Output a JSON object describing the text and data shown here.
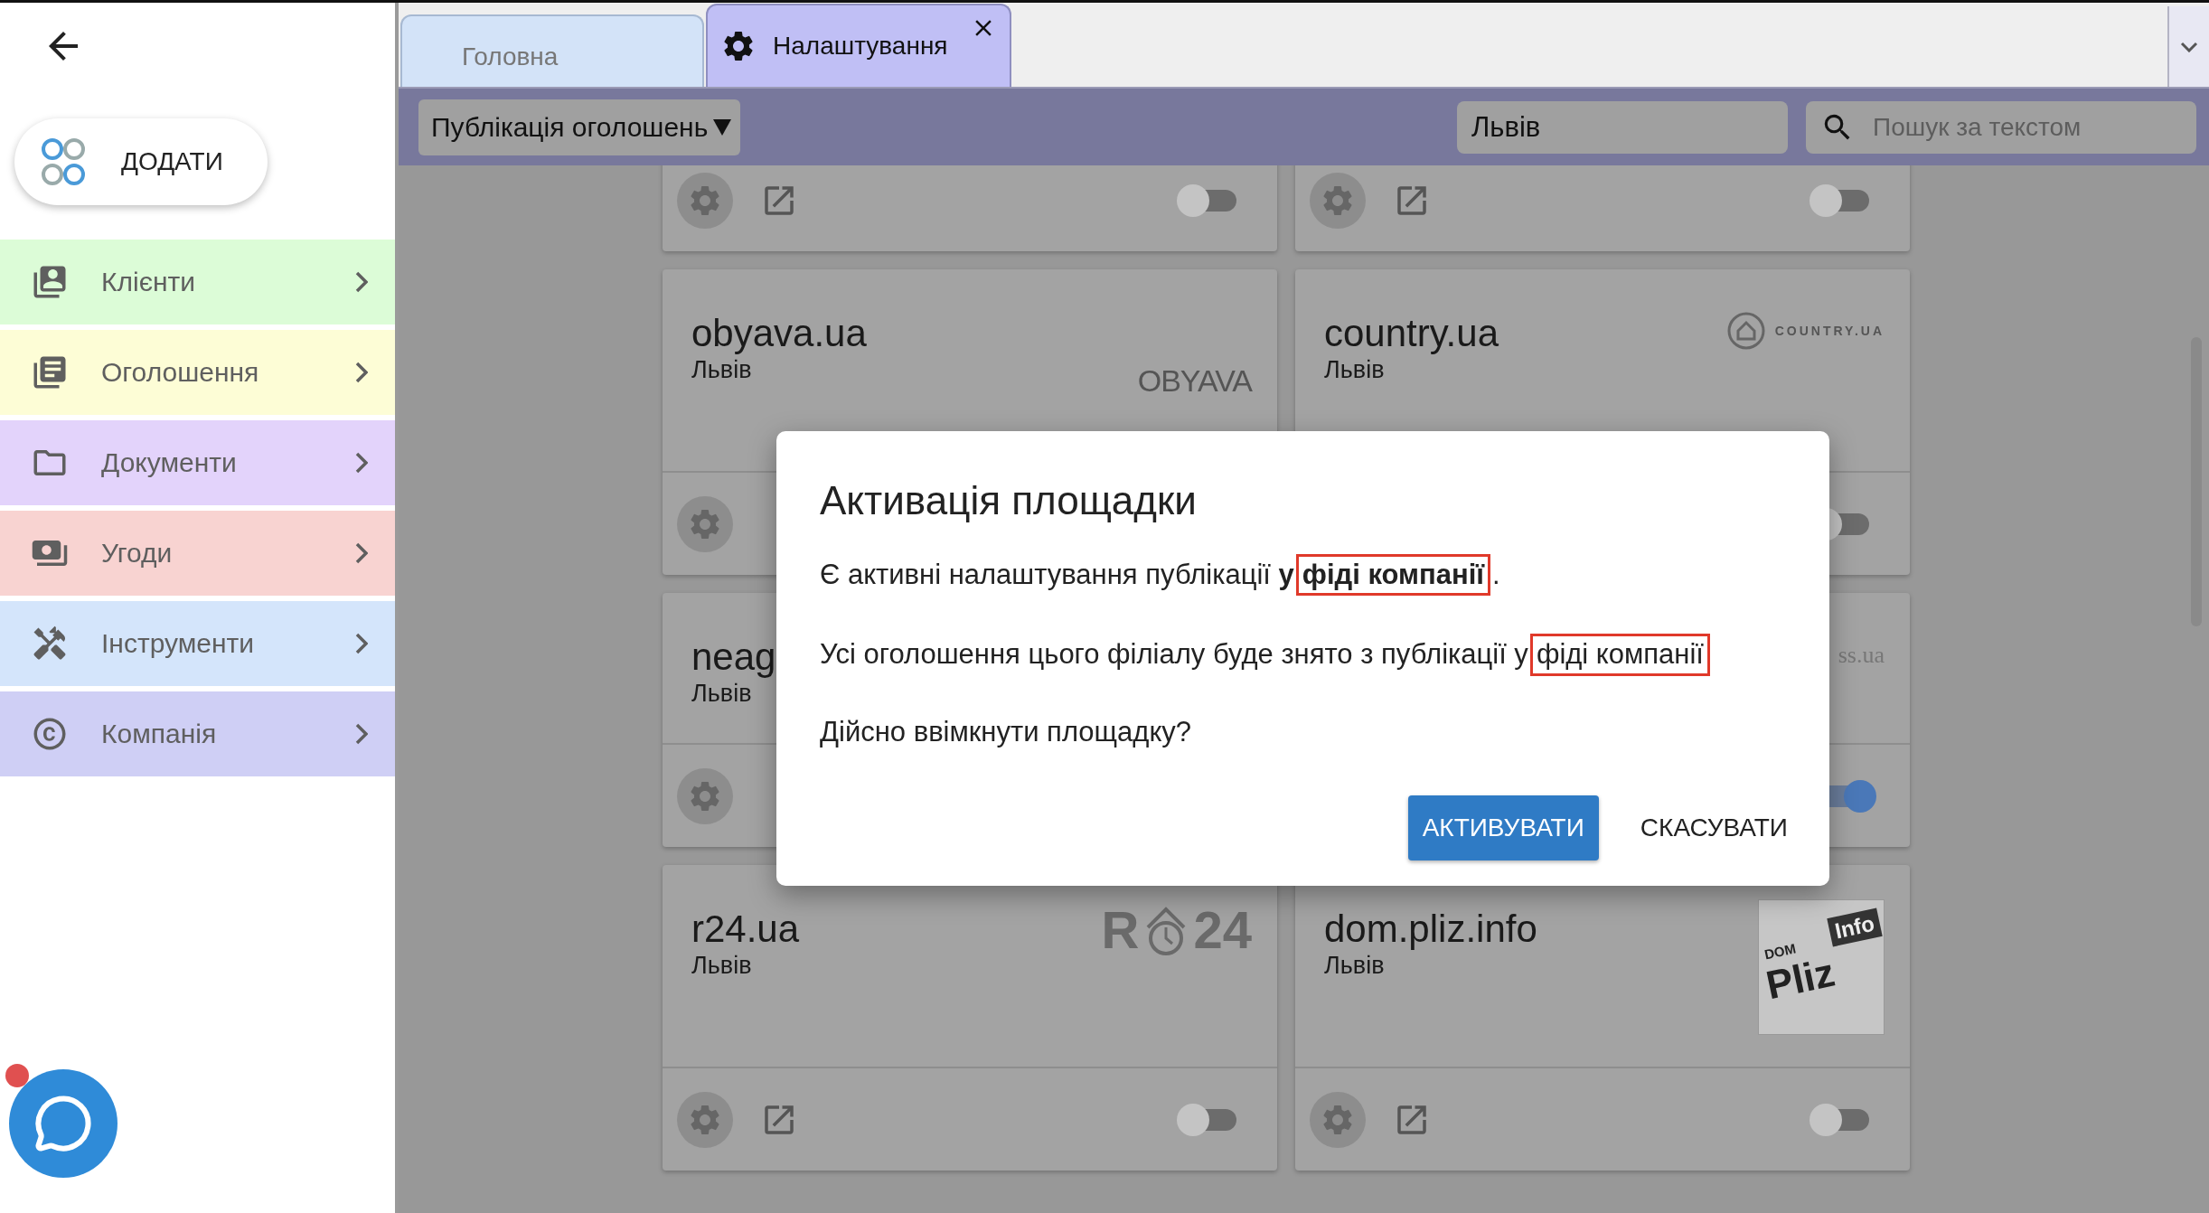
{
  "sidebar": {
    "add_button": "ДОДАТИ",
    "items": [
      {
        "label": "Клієнти",
        "color": "#dcfcd7"
      },
      {
        "label": "Оголошення",
        "color": "#fdfdd6"
      },
      {
        "label": "Документи",
        "color": "#e3d3fb"
      },
      {
        "label": "Угоди",
        "color": "#f8d3d1"
      },
      {
        "label": "Інструменти",
        "color": "#d4e5fb"
      },
      {
        "label": "Компанія",
        "color": "#cfcff5"
      }
    ],
    "chat": {
      "has_notification": true
    }
  },
  "tabs": [
    {
      "label": "Головна",
      "selected": false,
      "closable": false
    },
    {
      "label": "Налаштування",
      "selected": true,
      "closable": true
    }
  ],
  "toolbar": {
    "section": "Публікація оголошень",
    "city": "Львів",
    "search": {
      "placeholder": "Пошук за текстом"
    }
  },
  "cards": [
    {
      "footer": [
        {
          "kind": "settings"
        },
        {
          "kind": "link"
        },
        {
          "kind": "switch",
          "on": false
        }
      ]
    },
    {
      "footer": [
        {
          "kind": "settings"
        },
        {
          "kind": "link"
        },
        {
          "kind": "switch",
          "on": false
        }
      ]
    },
    {
      "title": "obyava.ua",
      "city": "Львів",
      "logo": {
        "kind": "plain",
        "texts": [
          "OBYAVA"
        ]
      },
      "footer": [
        {
          "kind": "settings"
        }
      ]
    },
    {
      "title": "country.ua",
      "city": "Львів",
      "logo": {
        "kind": "house",
        "texts": [
          "COUNTRY.UA"
        ]
      },
      "footer": [
        {
          "kind": "switch",
          "on": false
        }
      ]
    },
    {
      "title": "neag",
      "city": "Львів",
      "footer": [
        {
          "kind": "settings"
        }
      ]
    },
    {
      "logo": {
        "kind": "serif",
        "texts": [
          "ss.ua"
        ]
      },
      "footer": [
        {
          "kind": "switch",
          "on": true
        }
      ]
    },
    {
      "title": "r24.ua",
      "city": "Львів",
      "logo": {
        "kind": "split",
        "texts": [
          "R",
          "24"
        ]
      },
      "footer": [
        {
          "kind": "settings"
        },
        {
          "kind": "link"
        },
        {
          "kind": "switch",
          "on": false
        }
      ]
    },
    {
      "title": "dom.pliz.info",
      "city": "Львів",
      "logo": {
        "kind": "tile",
        "texts": [
          "DOM",
          "Pliz",
          "Info"
        ]
      },
      "footer": [
        {
          "kind": "settings"
        },
        {
          "kind": "link"
        },
        {
          "kind": "switch",
          "on": false
        }
      ]
    }
  ],
  "dialog": {
    "title": "Активація площадки",
    "paragraphs": [
      [
        {
          "text": "Є активні налаштування публікації ",
          "bold": false,
          "highlighted": false
        },
        {
          "text": "у",
          "bold": true,
          "highlighted": false
        },
        {
          "text": "фіді компанії",
          "bold": true,
          "highlighted": true
        },
        {
          "text": ".",
          "bold": false,
          "highlighted": false
        }
      ],
      [
        {
          "text": "Усі оголошення цього філіалу буде знято з публікації у",
          "bold": false,
          "highlighted": false
        },
        {
          "text": "фіді компанії",
          "bold": false,
          "highlighted": true
        }
      ],
      [
        {
          "text": "Дійсно ввімкнути площадку?",
          "bold": false,
          "highlighted": false
        }
      ]
    ],
    "buttons": [
      {
        "label": "АКТИВУВАТИ",
        "kind": "primary"
      },
      {
        "label": "СКАСУВАТИ",
        "kind": "text"
      }
    ]
  }
}
